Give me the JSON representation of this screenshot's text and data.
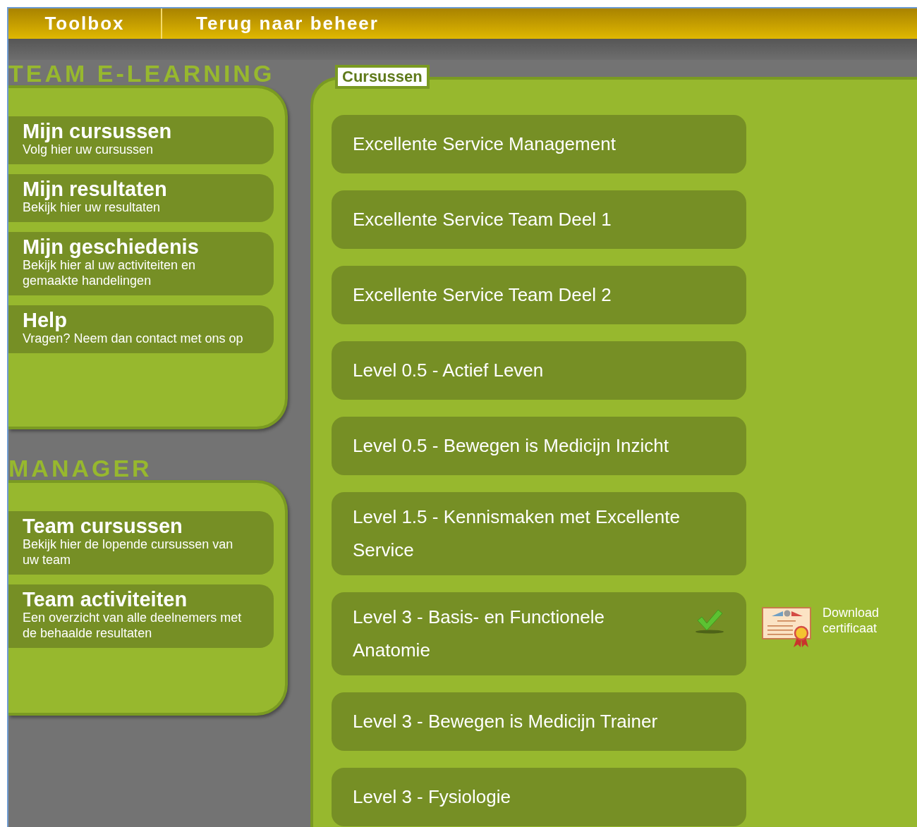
{
  "top_menu": [
    {
      "label": "Toolbox"
    },
    {
      "label": "Terug naar beheer"
    }
  ],
  "sections": [
    {
      "title": "TEAM E-LEARNING",
      "items": [
        {
          "title": "Mijn cursussen",
          "subtitle": "Volg hier uw cursussen"
        },
        {
          "title": "Mijn resultaten",
          "subtitle": "Bekijk hier uw resultaten"
        },
        {
          "title": "Mijn geschiedenis",
          "subtitle": "Bekijk hier al uw activiteiten en gemaakte handelingen"
        },
        {
          "title": "Help",
          "subtitle": "Vragen? Neem dan contact met ons op"
        }
      ]
    },
    {
      "title": "MANAGER",
      "items": [
        {
          "title": "Team cursussen",
          "subtitle": "Bekijk hier de lopende cursussen van uw team"
        },
        {
          "title": "Team activiteiten",
          "subtitle": "Een overzicht van alle deelnemers met de behaalde resultaten"
        }
      ]
    }
  ],
  "courses_panel": {
    "tab": "Cursussen",
    "courses": [
      {
        "title": "Excellente Service Management",
        "completed": false
      },
      {
        "title": "Excellente Service Team Deel 1",
        "completed": false
      },
      {
        "title": "Excellente Service Team Deel 2",
        "completed": false
      },
      {
        "title": "Level 0.5 - Actief Leven",
        "completed": false
      },
      {
        "title": "Level 0.5 - Bewegen is Medicijn Inzicht",
        "completed": false
      },
      {
        "title": "Level 1.5 - Kennismaken met Excellente Service",
        "completed": false
      },
      {
        "title": "Level 3 - Basis- en Functionele Anatomie",
        "completed": true,
        "certificate_link": "Download certificaat"
      },
      {
        "title": "Level 3 - Bewegen is Medicijn Trainer",
        "completed": false
      },
      {
        "title": "Level 3 - Fysiologie",
        "completed": false
      }
    ]
  }
}
